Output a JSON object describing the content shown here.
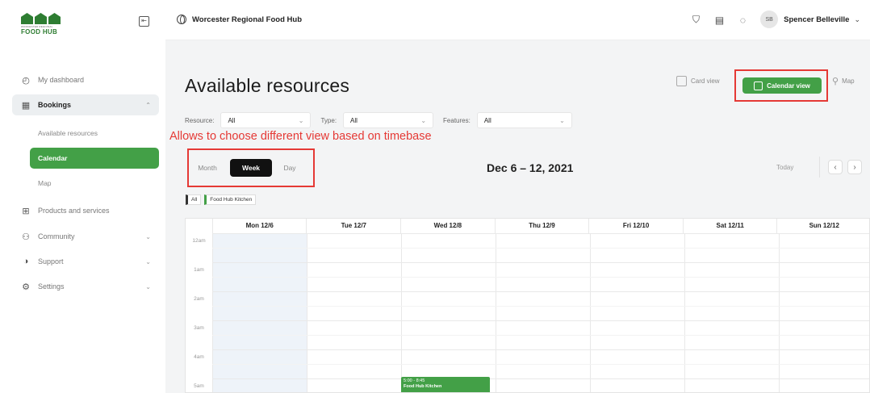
{
  "sidebar": {
    "logo": {
      "tiny_text": "WORCESTER REGIONAL",
      "brand": "FOOD HUB"
    },
    "collapse_icon": "collapse-sidebar-icon",
    "items": [
      {
        "label": "My dashboard",
        "icon": "dashboard-icon"
      },
      {
        "label": "Bookings",
        "icon": "bookings-icon",
        "expanded": true
      },
      {
        "label": "Products and services",
        "icon": "products-icon"
      },
      {
        "label": "Community",
        "icon": "community-icon"
      },
      {
        "label": "Support",
        "icon": "support-icon"
      },
      {
        "label": "Settings",
        "icon": "settings-icon"
      }
    ],
    "sub_items": [
      {
        "label": "Available resources"
      },
      {
        "label": "Calendar",
        "active": true
      },
      {
        "label": "Map"
      }
    ]
  },
  "topbar": {
    "org_name": "Worcester Regional Food Hub",
    "user_initials": "SB",
    "user_name": "Spencer Belleville"
  },
  "main": {
    "title": "Available resources",
    "views": {
      "card": "Card view",
      "calendar": "Calendar view",
      "map": "Map"
    },
    "filters": [
      {
        "label": "Resource:",
        "value": "All"
      },
      {
        "label": "Type:",
        "value": "All"
      },
      {
        "label": "Features:",
        "value": "All"
      }
    ],
    "annotation": "Allows to choose different view based on timebase",
    "periods": {
      "month": "Month",
      "week": "Week",
      "day": "Day",
      "selected": "Week"
    },
    "range": "Dec 6 – 12, 2021",
    "today": "Today",
    "legend": {
      "all": "All",
      "kitchen": "Food Hub Kitchen"
    },
    "calendar": {
      "days": [
        "Mon 12/6",
        "Tue 12/7",
        "Wed 12/8",
        "Thu 12/9",
        "Fri 12/10",
        "Sat 12/11",
        "Sun 12/12"
      ],
      "hours": [
        "12am",
        "1am",
        "2am",
        "3am",
        "4am",
        "5am"
      ],
      "event": {
        "time": "5:00 - 8:45",
        "title": "Food Hub Kitchen"
      }
    }
  },
  "colors": {
    "accent": "#43a047",
    "annotation": "#e53935",
    "background": "#f3f4f5"
  }
}
